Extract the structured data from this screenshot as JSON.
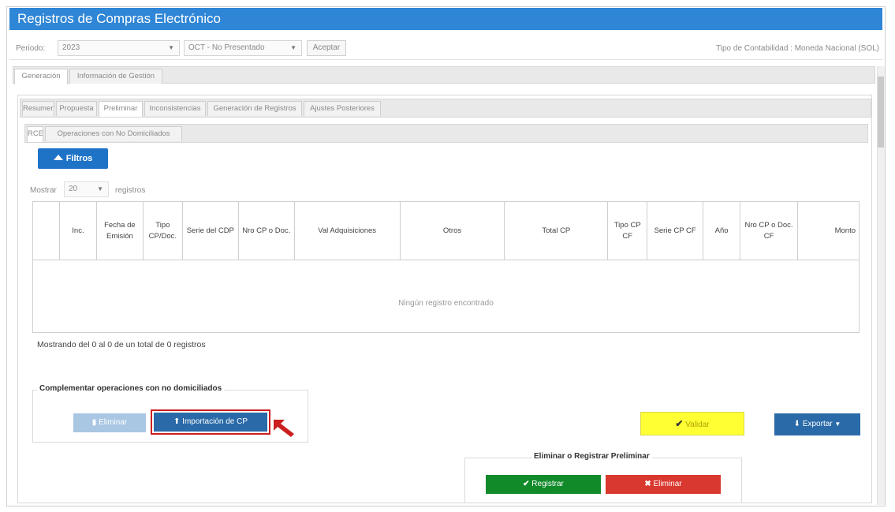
{
  "app": {
    "title": "Registros de Compras Electrónico"
  },
  "toolbar": {
    "periodo_label": "Periodo:",
    "year_value": "2023",
    "month_value": "OCT - No Presentado",
    "accept_label": "Aceptar",
    "contabilidad_text": "Tipo de Contabilidad : Moneda Nacional (SOL)"
  },
  "main_tabs": [
    "Generación",
    "Información de Gestión"
  ],
  "sub_tabs": [
    "Resumen",
    "Propuesta",
    "Preliminar",
    "Inconsistencias",
    "Generación de Registros",
    "Ajustes Posteriores"
  ],
  "inner_tabs": [
    "RCE",
    "Operaciones con No Domiciliados"
  ],
  "filters_button": "Filtros",
  "paging": {
    "show_label": "Mostrar",
    "page_size": "20",
    "records_label": "registros"
  },
  "table": {
    "columns": [
      "",
      "Inc.",
      "Fecha de Emisión",
      "Tipo CP/Doc.",
      "Serie del CDP",
      "Nro CP o Doc.",
      "Val Adquisiciones",
      "Otros",
      "Total CP",
      "Tipo CP CF",
      "Serie CP CF",
      "Año",
      "Nro CP o Doc. CF",
      "Monto"
    ],
    "empty_text": "Ningún registro encontrado",
    "summary": "Mostrando del 0 al 0 de un total de 0 registros"
  },
  "complement": {
    "title": "Complementar operaciones con no domiciliados",
    "delete_label": "Eliminar",
    "import_label": "Importación de CP"
  },
  "actions": {
    "validate_label": "Validar",
    "export_label": "Exportar"
  },
  "preliminar": {
    "title": "Eliminar o Registrar Preliminar",
    "register_label": "Registrar",
    "delete_label": "Eliminar"
  },
  "colors": {
    "title_bar": "#2f86d6",
    "primary_blue": "#1f73c7",
    "validate_yellow": "#ffff33",
    "register_green": "#118a2a",
    "delete_red": "#d9382f",
    "highlight_red": "#cc1f1f"
  }
}
